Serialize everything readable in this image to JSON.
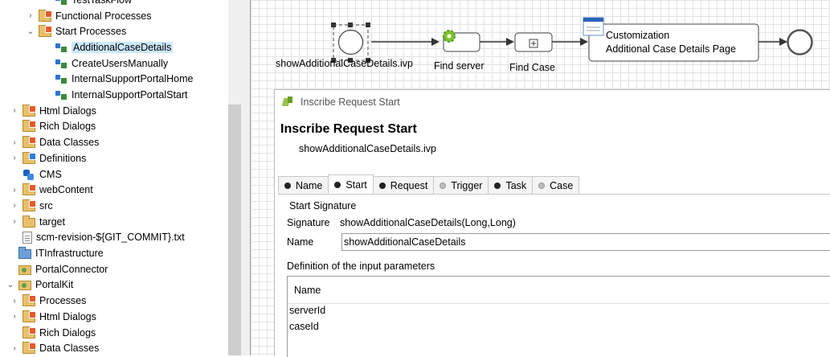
{
  "tree": {
    "items": [
      {
        "label": "TestTaskFlow",
        "indent": 2,
        "twisty": "",
        "icon": "process"
      },
      {
        "label": "Functional Processes",
        "indent": 1,
        "twisty": "›",
        "icon": "folder-badge"
      },
      {
        "label": "Start Processes",
        "indent": 1,
        "twisty": "⌄",
        "icon": "folder-badge"
      },
      {
        "label": "AdditionalCaseDetails",
        "indent": 2,
        "twisty": "",
        "icon": "process",
        "selected": true
      },
      {
        "label": "CreateUsersManually",
        "indent": 2,
        "twisty": "",
        "icon": "process"
      },
      {
        "label": "InternalSupportPortalHome",
        "indent": 2,
        "twisty": "",
        "icon": "process"
      },
      {
        "label": "InternalSupportPortalStart",
        "indent": 2,
        "twisty": "",
        "icon": "process"
      },
      {
        "label": "Html Dialogs",
        "indent": 0,
        "twisty": "›",
        "icon": "folder-badge"
      },
      {
        "label": "Rich Dialogs",
        "indent": 0,
        "twisty": "",
        "icon": "folder-badge"
      },
      {
        "label": "Data Classes",
        "indent": 0,
        "twisty": "›",
        "icon": "folder-badge"
      },
      {
        "label": "Definitions",
        "indent": 0,
        "twisty": "›",
        "icon": "folder-badge-blue"
      },
      {
        "label": "CMS",
        "indent": 0,
        "twisty": "",
        "icon": "cms"
      },
      {
        "label": "webContent",
        "indent": 0,
        "twisty": "›",
        "icon": "folder-badge"
      },
      {
        "label": "src",
        "indent": 0,
        "twisty": "›",
        "icon": "folder-badge"
      },
      {
        "label": "target",
        "indent": 0,
        "twisty": "›",
        "icon": "folder"
      },
      {
        "label": "scm-revision-${GIT_COMMIT}.txt",
        "indent": 0,
        "twisty": "",
        "icon": "file"
      },
      {
        "label": "ITInfrastructure",
        "indent": -1,
        "twisty": "",
        "icon": "project"
      },
      {
        "label": "PortalConnector",
        "indent": -1,
        "twisty": "",
        "icon": "kit"
      },
      {
        "label": "PortalKit",
        "indent": -1,
        "twisty": "⌄",
        "icon": "kit"
      },
      {
        "label": "Processes",
        "indent": 0,
        "twisty": "›",
        "icon": "folder-badge"
      },
      {
        "label": "Html Dialogs",
        "indent": 0,
        "twisty": "›",
        "icon": "folder-badge"
      },
      {
        "label": "Rich Dialogs",
        "indent": 0,
        "twisty": "",
        "icon": "folder-badge"
      },
      {
        "label": "Data Classes",
        "indent": 0,
        "twisty": "›",
        "icon": "folder-badge"
      }
    ]
  },
  "canvas": {
    "start_label": "showAdditionalCaseDetails.ivp",
    "find_server_label": "Find server",
    "find_case_label": "Find Case",
    "customization_line1": "Customization",
    "customization_line2": "Additional Case Details Page"
  },
  "dialog": {
    "window_title": "Inscribe Request Start",
    "heading": "Inscribe Request Start",
    "subtitle": "showAdditionalCaseDetails.ivp",
    "tabs": [
      {
        "label": "Name",
        "active": false,
        "enabled": true
      },
      {
        "label": "Start",
        "active": true,
        "enabled": true
      },
      {
        "label": "Request",
        "active": false,
        "enabled": true
      },
      {
        "label": "Trigger",
        "active": false,
        "enabled": false
      },
      {
        "label": "Task",
        "active": false,
        "enabled": true
      },
      {
        "label": "Case",
        "active": false,
        "enabled": false
      }
    ],
    "start_signature_title": "Start Signature",
    "signature_label": "Signature",
    "signature_value": "showAdditionalCaseDetails(Long,Long)",
    "name_label": "Name",
    "name_value": "showAdditionalCaseDetails",
    "params_title": "Definition of the input parameters",
    "params_header": "Name",
    "params": [
      "serverId",
      "caseId"
    ]
  }
}
